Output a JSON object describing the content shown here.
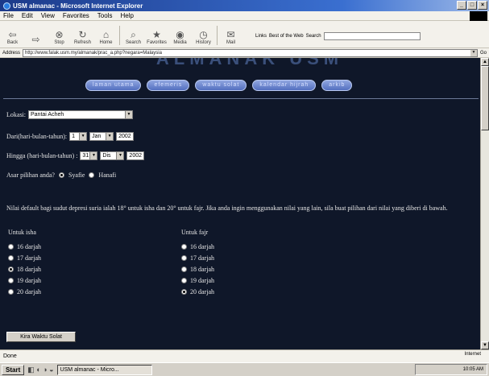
{
  "window": {
    "title": "USM almanac - Microsoft Internet Explorer"
  },
  "menu": [
    "File",
    "Edit",
    "View",
    "Favorites",
    "Tools",
    "Help"
  ],
  "toolbar": {
    "buttons": [
      {
        "label": "Back",
        "icon": "back-icon",
        "glyph": "⇦"
      },
      {
        "label": "",
        "icon": "forward-icon",
        "glyph": "⇨"
      },
      {
        "label": "Stop",
        "icon": "stop-icon",
        "glyph": "⊗"
      },
      {
        "label": "Refresh",
        "icon": "refresh-icon",
        "glyph": "↻"
      },
      {
        "label": "Home",
        "icon": "home-icon",
        "glyph": "⌂"
      },
      {
        "label": "Search",
        "icon": "search-icon",
        "glyph": "⌕"
      },
      {
        "label": "Favorites",
        "icon": "favorites-icon",
        "glyph": "★"
      },
      {
        "label": "Media",
        "icon": "media-icon",
        "glyph": "◉"
      },
      {
        "label": "History",
        "icon": "history-icon",
        "glyph": "◷"
      },
      {
        "label": "Mail",
        "icon": "mail-icon",
        "glyph": "✉"
      }
    ],
    "links_label": "Links",
    "best_of_web": "Best of the Web",
    "search_label": "Search"
  },
  "address": {
    "label": "Address",
    "url": "http://www.falak.usm.my/almanak/prac_a.php?negara=Malaysia",
    "go": "Go"
  },
  "page": {
    "banner": "ALMANAK USM",
    "nav": [
      "laman utama",
      "efemeris",
      "waktu solat",
      "kalendar hijrah",
      "arkib"
    ],
    "lokasi_label": "Lokasi:",
    "lokasi_value": "Pantai Acheh",
    "dari_label": "Dari(hari-bulan-tahun):",
    "dari_day": "1",
    "dari_month": "Jan",
    "dari_year": "2002",
    "hingga_label": "Hingga (hari-bulan-tahun) :",
    "hingga_day": "31",
    "hingga_month": "Dis",
    "hingga_year": "2002",
    "asar_label": "Asar pilihan anda?",
    "asar_options": [
      "Syafie",
      "Hanafi"
    ],
    "note": "Nilai default bagi sudut depresi suria ialah 18° untuk isha dan 20° untuk fajr. Jika anda ingin menggunakan nilai yang lain, sila buat pilihan dari nilai yang diberi di bawah.",
    "isha_header": "Untuk isha",
    "isha_options": [
      "16 darjah",
      "17 darjah",
      "18 darjah",
      "19 darjah",
      "20 darjah"
    ],
    "isha_selected": "18 darjah",
    "fajr_header": "Untuk fajr",
    "fajr_options": [
      "16 darjah",
      "17 darjah",
      "18 darjah",
      "19 darjah",
      "20 darjah"
    ],
    "fajr_selected": "20 darjah",
    "submit": "Kira Waktu Solat"
  },
  "status": {
    "text": "Done",
    "zone": "Internet"
  },
  "taskbar": {
    "start": "Start",
    "task": "USM almanac - Micro...",
    "clock": "10:05 AM"
  }
}
